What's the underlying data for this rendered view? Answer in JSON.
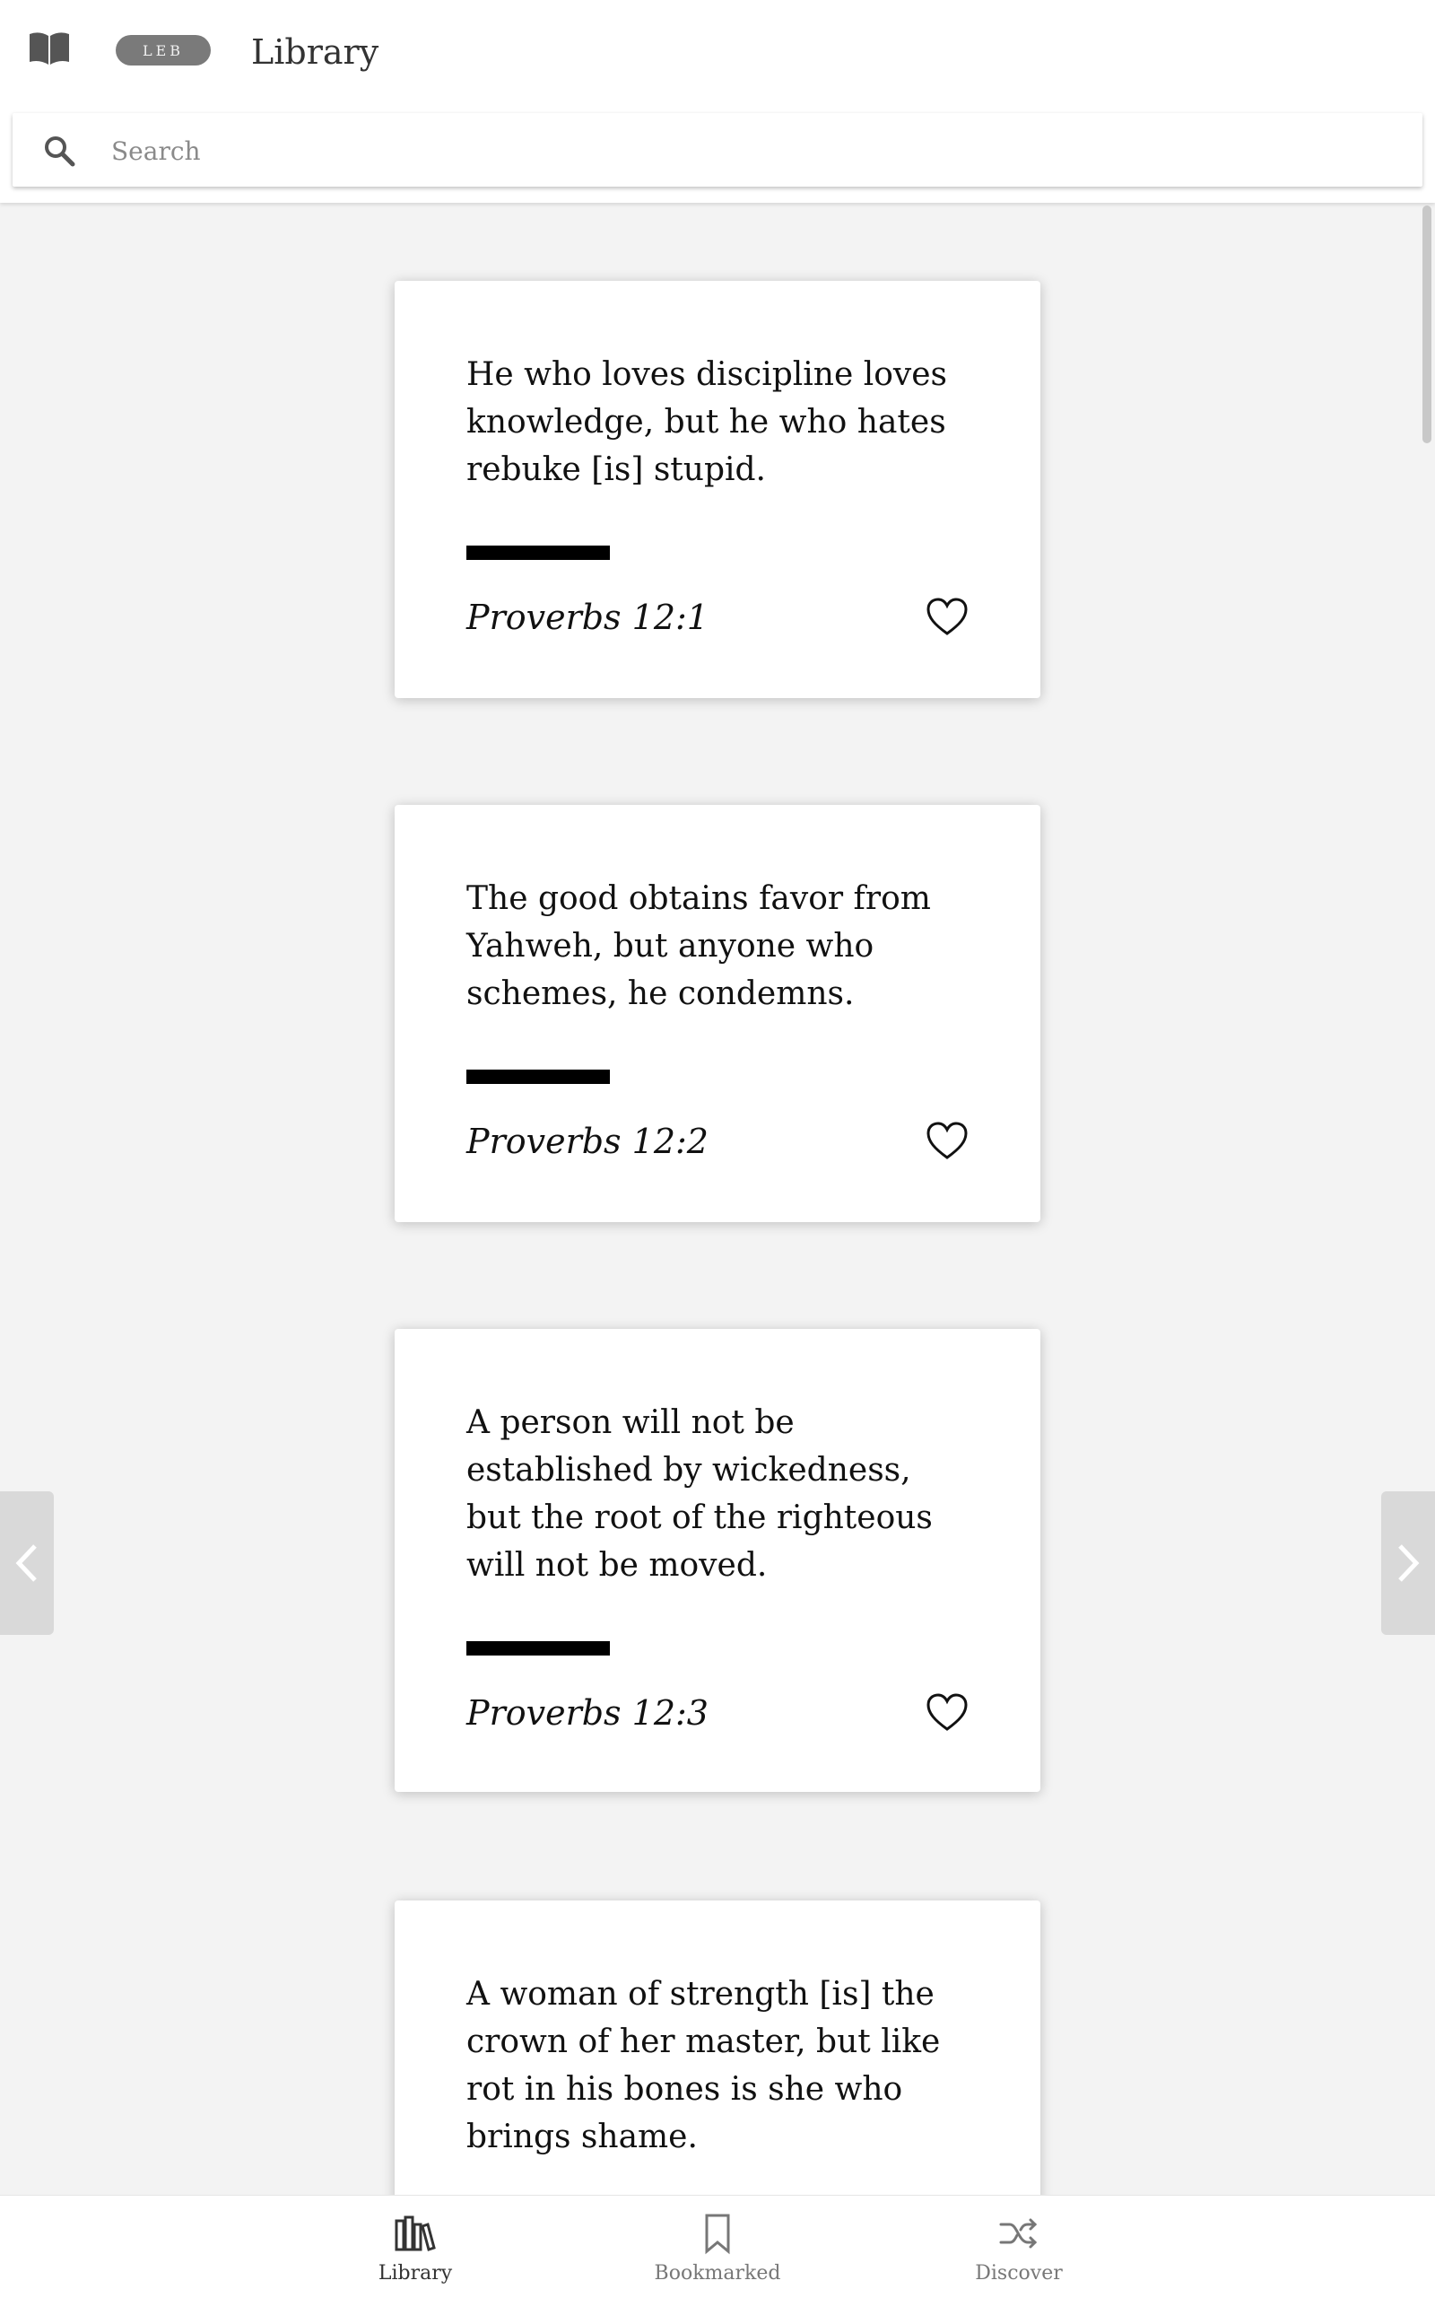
{
  "header": {
    "version_badge": "LEB",
    "title": "Library"
  },
  "search": {
    "placeholder": "Search",
    "value": ""
  },
  "cards": [
    {
      "text": "He who loves discipline loves knowledge, but he who hates rebuke [is] stupid.",
      "reference": "Proverbs 12:1",
      "favorited": false
    },
    {
      "text": "The good obtains favor from Yahweh, but anyone who schemes, he condemns.",
      "reference": "Proverbs 12:2",
      "favorited": false
    },
    {
      "text": "A person will not be established by wickedness, but the root of the righteous will not be moved.",
      "reference": "Proverbs 12:3",
      "favorited": false
    },
    {
      "text": "A woman of strength [is] the crown of her master, but like rot in his bones is she who brings shame.",
      "reference": "",
      "favorited": false
    }
  ],
  "bottom_nav": {
    "items": [
      {
        "label": "Library",
        "icon": "books-icon",
        "active": true
      },
      {
        "label": "Bookmarked",
        "icon": "bookmark-icon",
        "active": false
      },
      {
        "label": "Discover",
        "icon": "shuffle-icon",
        "active": false
      }
    ]
  },
  "colors": {
    "background": "#f3f3f3",
    "card": "#ffffff",
    "badge": "#7a7a7a",
    "nav_active": "#333333",
    "nav_inactive": "#8a8a8a"
  }
}
